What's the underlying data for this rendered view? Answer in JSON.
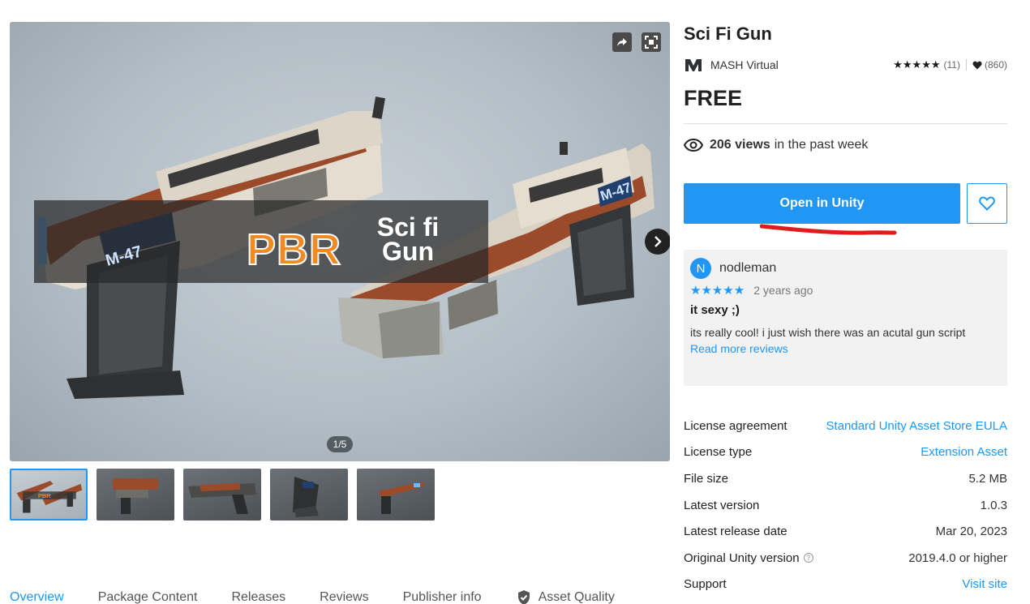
{
  "gallery": {
    "banner_main": "PBR",
    "banner_line1": "Sci fi",
    "banner_line2": "Gun",
    "gun_label_left": "M-47",
    "gun_label_right": "M-47",
    "counter": "1/5",
    "thumbnail_count": 5,
    "selected_thumbnail": 1
  },
  "product": {
    "title": "Sci Fi Gun",
    "publisher": "MASH Virtual",
    "rating_stars": "★★★★★",
    "rating_count": "(11)",
    "favorites_count": "(860)",
    "price": "FREE",
    "views_count": "206 views",
    "views_suffix": "in the past week",
    "open_button": "Open in Unity"
  },
  "review": {
    "avatar_letter": "N",
    "user": "nodleman",
    "stars": "★★★★★",
    "date": "2 years ago",
    "title": "it sexy ;)",
    "body": "its really cool! i just wish there was an acutal gun script",
    "more_link": "Read more reviews"
  },
  "details": [
    {
      "label": "License agreement",
      "value": "Standard Unity Asset Store EULA",
      "link": true
    },
    {
      "label": "License type",
      "value": "Extension Asset",
      "link": true
    },
    {
      "label": "File size",
      "value": "5.2 MB",
      "link": false
    },
    {
      "label": "Latest version",
      "value": "1.0.3",
      "link": false
    },
    {
      "label": "Latest release date",
      "value": "Mar 20, 2023",
      "link": false
    },
    {
      "label": "Original Unity version",
      "value": "2019.4.0 or higher",
      "link": false
    },
    {
      "label": "Support",
      "value": "Visit site",
      "link": true
    }
  ],
  "tabs": [
    "Overview",
    "Package Content",
    "Releases",
    "Reviews",
    "Publisher info",
    "Asset Quality"
  ],
  "colors": {
    "accent": "#2196f3",
    "banner_orange": "#f28a23",
    "annotation_red": "#e01b1b"
  }
}
